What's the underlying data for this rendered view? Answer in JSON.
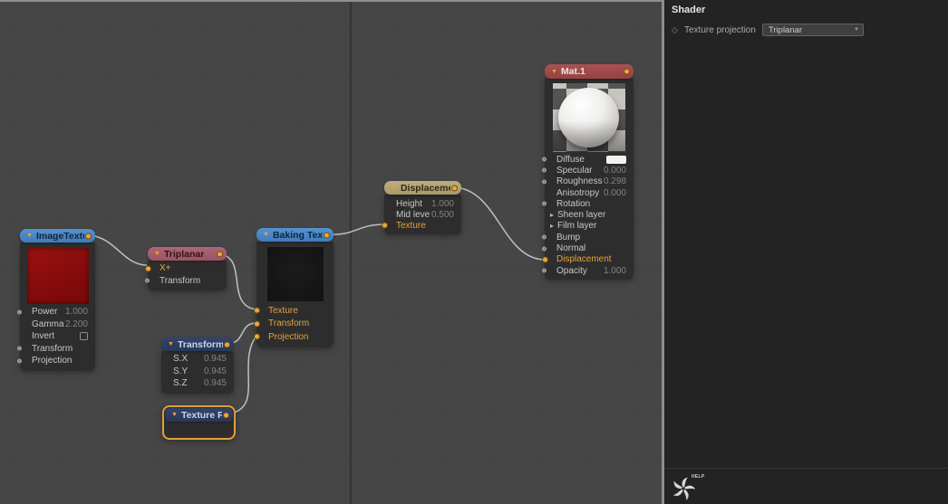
{
  "colors": {
    "accent_orange": "#e9a83c",
    "wire": "#cbcbcb",
    "canvas_bg": "#464646",
    "panel_bg": "#232323",
    "node_bg": "#2d2d2d",
    "header_blue": "#4a86c4",
    "header_rose": "#a55d6e",
    "header_maroon": "#a04a4a",
    "header_navy": "#2e3c62",
    "header_tan": "#b3a476",
    "selection_outline": "#e2a23a"
  },
  "icons": {
    "collapse": "▼",
    "expand": "▸",
    "diamond": "◇",
    "dropdown_arrow": "▼"
  },
  "panel": {
    "title": "Shader",
    "property": {
      "label": "Texture projection",
      "value": "Triplanar"
    },
    "help_label": "HELP"
  },
  "nodes": {
    "image_texture": {
      "title": "ImageTexture",
      "rows": [
        {
          "label": "Power",
          "value": "1.000"
        },
        {
          "label": "Gamma",
          "value": "2.200"
        },
        {
          "label": "Invert",
          "value": ""
        },
        {
          "label": "Transform",
          "value": ""
        },
        {
          "label": "Projection",
          "value": ""
        }
      ]
    },
    "triplanar": {
      "title": "Triplanar",
      "rows": [
        {
          "label": "X+",
          "value": ""
        },
        {
          "label": "Transform",
          "value": ""
        }
      ]
    },
    "transform": {
      "title": "Transform",
      "rows": [
        {
          "label": "S.X",
          "value": "0.945"
        },
        {
          "label": "S.Y",
          "value": "0.945"
        },
        {
          "label": "S.Z",
          "value": "0.945"
        }
      ]
    },
    "texture_proj": {
      "title": "Texture Proj"
    },
    "baking_texture": {
      "title": "Baking Textur",
      "rows": [
        {
          "label": "Texture",
          "value": ""
        },
        {
          "label": "Transform",
          "value": ""
        },
        {
          "label": "Projection",
          "value": ""
        }
      ]
    },
    "displacement": {
      "title": "Displacement",
      "rows": [
        {
          "label": "Height",
          "value": "1.000"
        },
        {
          "label": "Mid leve",
          "value": "0.500"
        },
        {
          "label": "Texture",
          "value": ""
        }
      ]
    },
    "mat1": {
      "title": "Mat.1",
      "rows": [
        {
          "label": "Diffuse",
          "value": ""
        },
        {
          "label": "Specular",
          "value": "0.000"
        },
        {
          "label": "Roughness",
          "value": "0.298"
        },
        {
          "label": "Anisotropy",
          "value": "0.000"
        },
        {
          "label": "Rotation",
          "value": ""
        },
        {
          "label": "Sheen layer",
          "value": ""
        },
        {
          "label": "Film layer",
          "value": ""
        },
        {
          "label": "Bump",
          "value": ""
        },
        {
          "label": "Normal",
          "value": ""
        },
        {
          "label": "Displacement",
          "value": ""
        },
        {
          "label": "Opacity",
          "value": "1.000"
        }
      ]
    }
  }
}
